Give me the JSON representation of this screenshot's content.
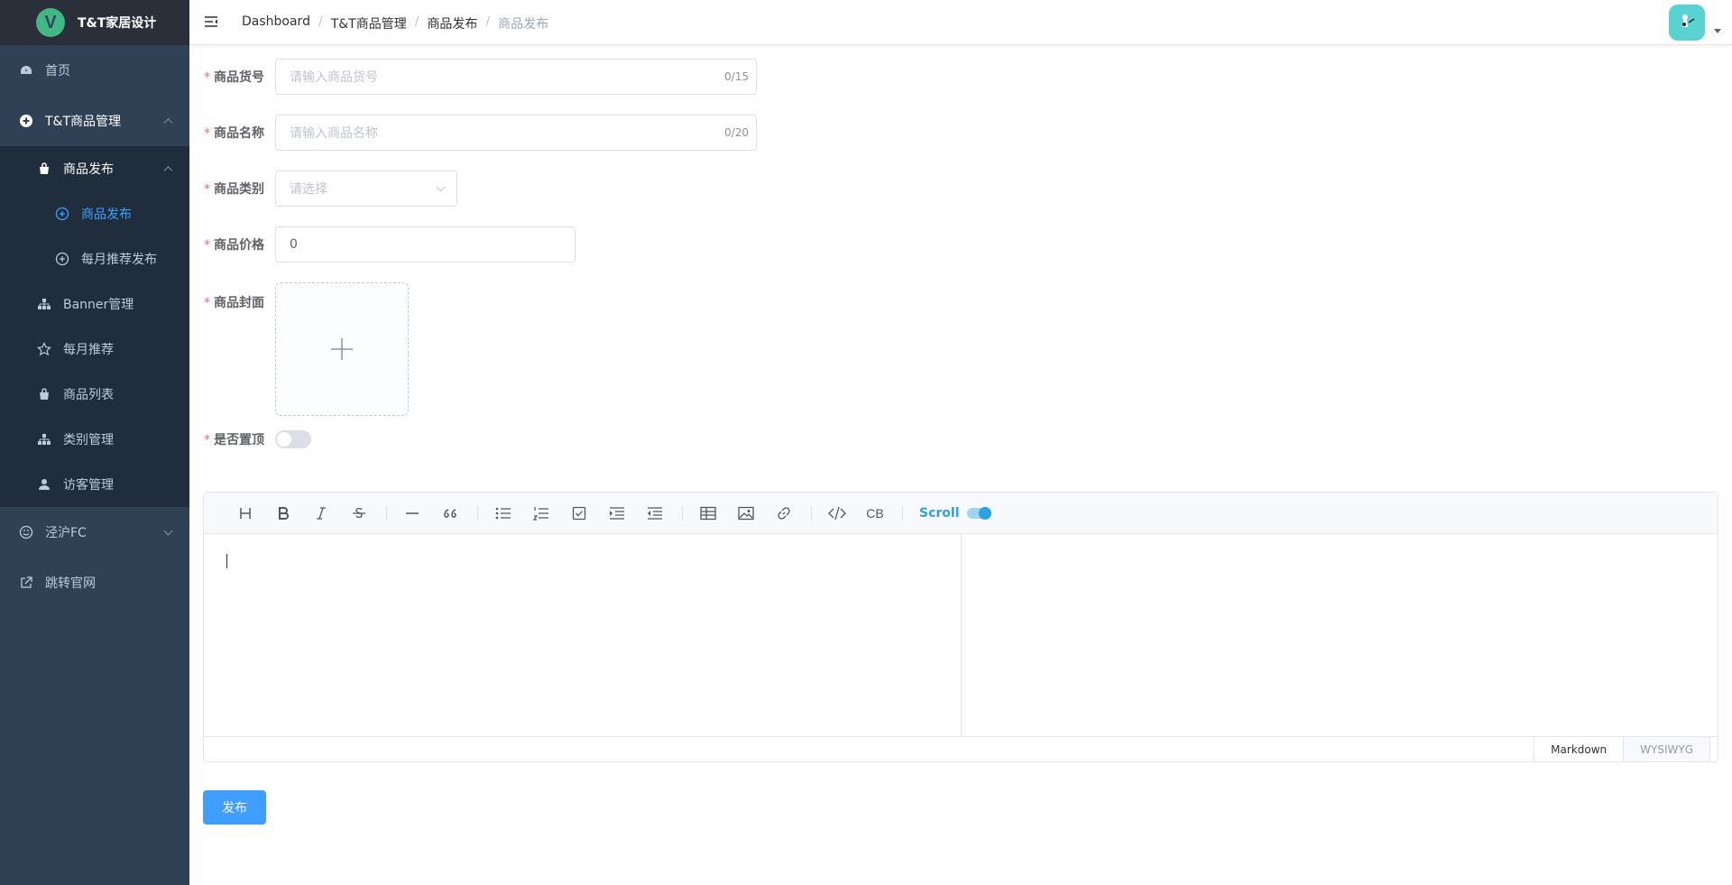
{
  "app": {
    "title": "T&T家居设计",
    "logo_letter": "V"
  },
  "sidebar": {
    "items": [
      {
        "label": "首页",
        "icon": "dashboard-icon"
      },
      {
        "label": "T&T商品管理",
        "icon": "plus-circle-icon",
        "expanded": true
      },
      {
        "label": "商品发布",
        "icon": "shopping-bag-icon",
        "expanded": true
      },
      {
        "label": "商品发布",
        "icon": "plus-circle-outline-icon",
        "active": true
      },
      {
        "label": "每月推荐发布",
        "icon": "plus-circle-outline-icon"
      },
      {
        "label": "Banner管理",
        "icon": "tree-icon"
      },
      {
        "label": "每月推荐",
        "icon": "star-icon"
      },
      {
        "label": "商品列表",
        "icon": "shopping-bag-icon"
      },
      {
        "label": "类别管理",
        "icon": "tree-icon"
      },
      {
        "label": "访客管理",
        "icon": "user-icon"
      },
      {
        "label": "泾沪FC",
        "icon": "smile-icon",
        "expanded": false
      },
      {
        "label": "跳转官网",
        "icon": "external-link-icon"
      }
    ]
  },
  "navbar": {
    "breadcrumb": [
      "Dashboard",
      "T&T商品管理",
      "商品发布",
      "商品发布"
    ],
    "separator": "/"
  },
  "form": {
    "sku": {
      "label": "商品货号",
      "placeholder": "请输入商品货号",
      "count": "0/15"
    },
    "name": {
      "label": "商品名称",
      "placeholder": "请输入商品名称",
      "count": "0/20"
    },
    "category": {
      "label": "商品类别",
      "placeholder": "请选择"
    },
    "price": {
      "label": "商品价格",
      "value": "0"
    },
    "cover": {
      "label": "商品封面"
    },
    "pinned": {
      "label": "是否置顶",
      "on": false
    },
    "required_mark": "*"
  },
  "editor": {
    "scroll_label": "Scroll",
    "modes": [
      "Markdown",
      "WYSIWYG"
    ],
    "toolbar_cb": "CB"
  },
  "actions": {
    "submit_label": "发布"
  },
  "colors": {
    "sidebar_bg": "#304156",
    "primary": "#409eff",
    "active_menu": "#409eff"
  }
}
